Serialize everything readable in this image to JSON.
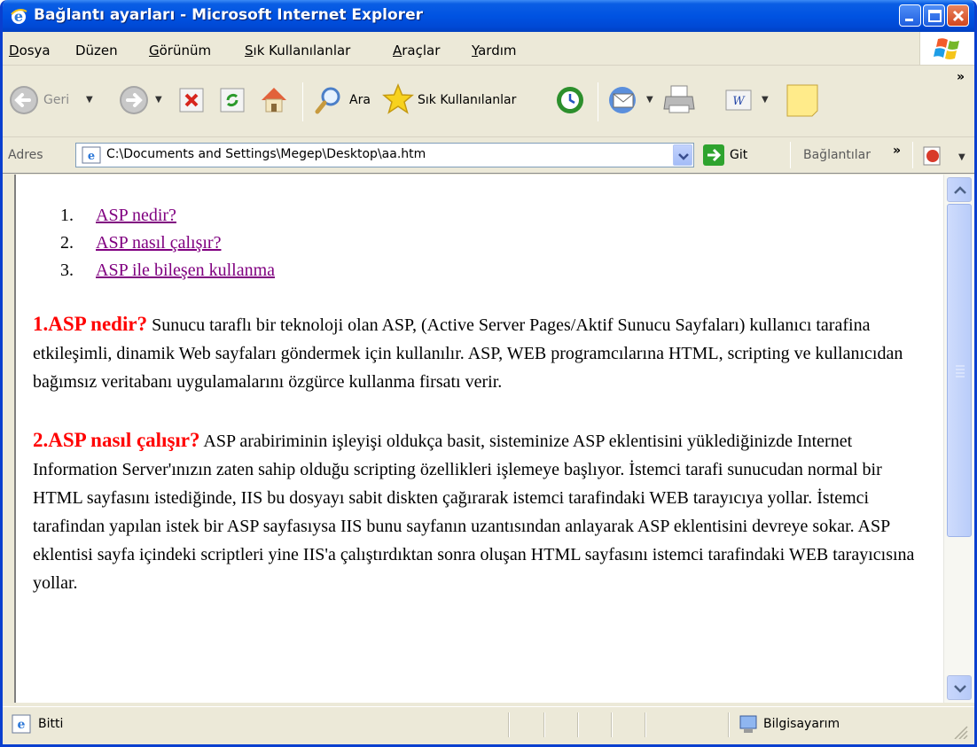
{
  "window": {
    "title": "Bağlantı ayarları - Microsoft Internet Explorer"
  },
  "menu": {
    "items": [
      {
        "first": "D",
        "rest": "osya"
      },
      {
        "first": "Düzen",
        "rest": ""
      },
      {
        "first": "G",
        "rest": "örünüm"
      },
      {
        "first": "S",
        "rest": "ık Kullanılanlar"
      },
      {
        "first": "A",
        "rest": "raçlar"
      },
      {
        "first": "Y",
        "rest": "ardım"
      }
    ]
  },
  "toolbar": {
    "back_label": "Geri",
    "search_label": "Ara",
    "favorites_label": "Sık Kullanılanlar",
    "overflow": "»"
  },
  "address": {
    "label": "Adres",
    "url": "C:\\Documents and Settings\\Megep\\Desktop\\aa.htm",
    "go_label": "Git",
    "links_label": "Bağlantılar",
    "links_overflow": "»"
  },
  "page": {
    "toc": [
      {
        "num": "1.",
        "text": "ASP nedir?"
      },
      {
        "num": "2.",
        "text": "ASP nasıl çalışır?"
      },
      {
        "num": "3.",
        "text": "ASP ile bileşen kullanma"
      }
    ],
    "sections": [
      {
        "heading": "1.ASP nedir?",
        "body": "Sunucu taraflı bir teknoloji olan ASP, (Active Server Pages/Aktif Sunucu Sayfaları) kullanıcı tarafina etkileşimli, dinamik Web sayfaları göndermek için kullanılır. ASP, WEB programcılarına HTML, scripting ve kullanıcıdan bağımsız veritabanı uygulamalarını özgürce kullanma firsatı verir."
      },
      {
        "heading": "2.ASP nasıl çalışır?",
        "body": "ASP arabiriminin işleyişi oldukça basit, sisteminize ASP eklentisini yüklediğinizde Internet Information Server'ınızın zaten sahip olduğu scripting özellikleri işlemeye başlıyor. İstemci tarafi sunucudan normal bir HTML sayfasını istediğinde, IIS bu dosyayı sabit diskten çağırarak istemci tarafindaki WEB tarayıcıya yollar. İstemci tarafindan yapılan istek bir ASP sayfasıysa IIS bunu sayfanın uzantısından anlayarak ASP eklentisini devreye sokar. ASP eklentisi sayfa içindeki scriptleri yine IIS'a çalıştırdıktan sonra oluşan HTML sayfasını istemci tarafindaki WEB tarayıcısına yollar."
      }
    ]
  },
  "status": {
    "text": "Bitti",
    "zone": "Bilgisayarım"
  },
  "colors": {
    "title_bar": "#0053e2",
    "link_visited": "#800080",
    "heading_red": "#ff0000"
  }
}
